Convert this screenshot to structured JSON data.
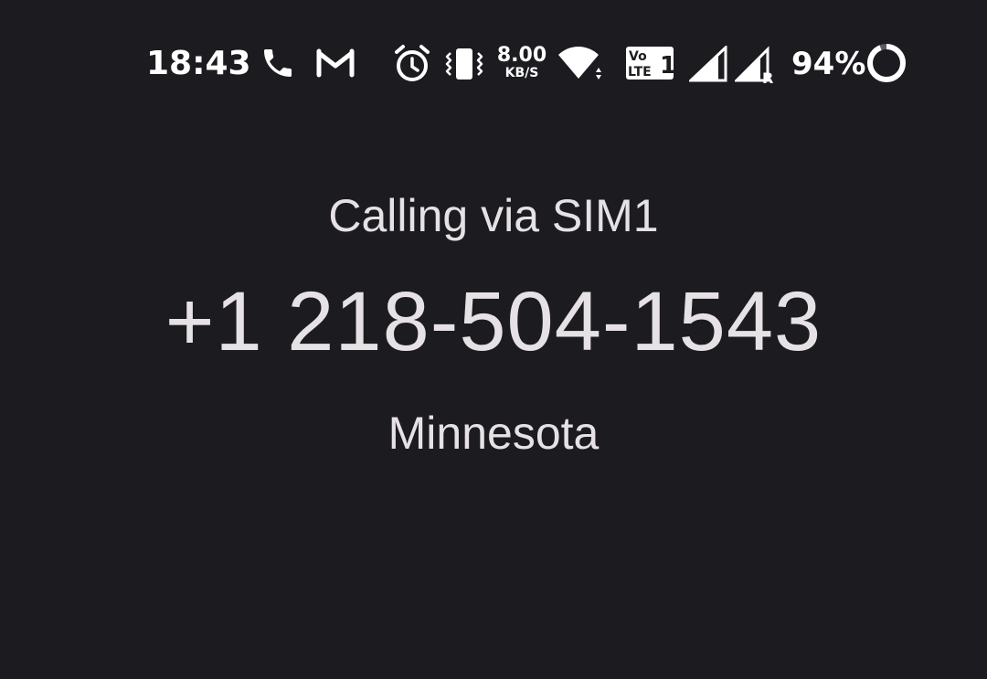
{
  "status_bar": {
    "time": "18:43",
    "network_speed_value": "8.00",
    "network_speed_unit": "KB/S",
    "volte_label_top": "Vo",
    "volte_label_bottom": "LTE",
    "volte_sim": "1",
    "roaming_indicator": "R",
    "battery_percent": "94%",
    "battery_level": 0.94,
    "icons": [
      "phone-call-icon",
      "gmail-icon",
      "alarm-icon",
      "vibrate-icon",
      "wifi-icon",
      "volte-icon",
      "signal-sim1-icon",
      "signal-sim2-roaming-icon",
      "battery-ring-icon"
    ]
  },
  "call": {
    "calling_via": "Calling via SIM1",
    "number": "+1 218-504-1543",
    "location": "Minnesota"
  },
  "colors": {
    "background": "#1c1b1f",
    "text": "#e6e1e5",
    "status_icons": "#ffffff"
  }
}
